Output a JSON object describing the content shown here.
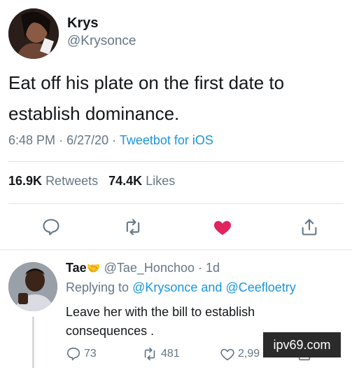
{
  "tweet": {
    "author_name": "Krys",
    "author_handle": "@Krysonce",
    "text": "Eat off his plate on the first date to establish dominance.",
    "time": "6:48 PM",
    "date": "6/27/20",
    "separator": "·",
    "source": "Tweetbot for iOS",
    "retweets_count": "16.9K",
    "retweets_label": "Retweets",
    "likes_count": "74.4K",
    "likes_label": "Likes",
    "liked": true,
    "like_color": "#e0245e"
  },
  "actions": [
    {
      "icon": "reply-icon"
    },
    {
      "icon": "retweet-icon"
    },
    {
      "icon": "heart-filled-icon"
    },
    {
      "icon": "share-icon"
    }
  ],
  "reply": {
    "author_name": "Tae",
    "emoji": "🤝",
    "author_handle": "@Tae_Honchoo",
    "age": "1d",
    "replying_prefix": "Replying to",
    "mention_1": "@Krysonce",
    "and_word": "and",
    "mention_2": "@Ceefloetry",
    "text": "Leave her with the bill to establish consequences .",
    "reply_count": "73",
    "retweet_count": "481",
    "like_count": "2,99"
  },
  "watermark": "ipv69.com",
  "colors": {
    "link": "#1b95e0",
    "secondary_text": "#657786",
    "like": "#e0245e"
  }
}
